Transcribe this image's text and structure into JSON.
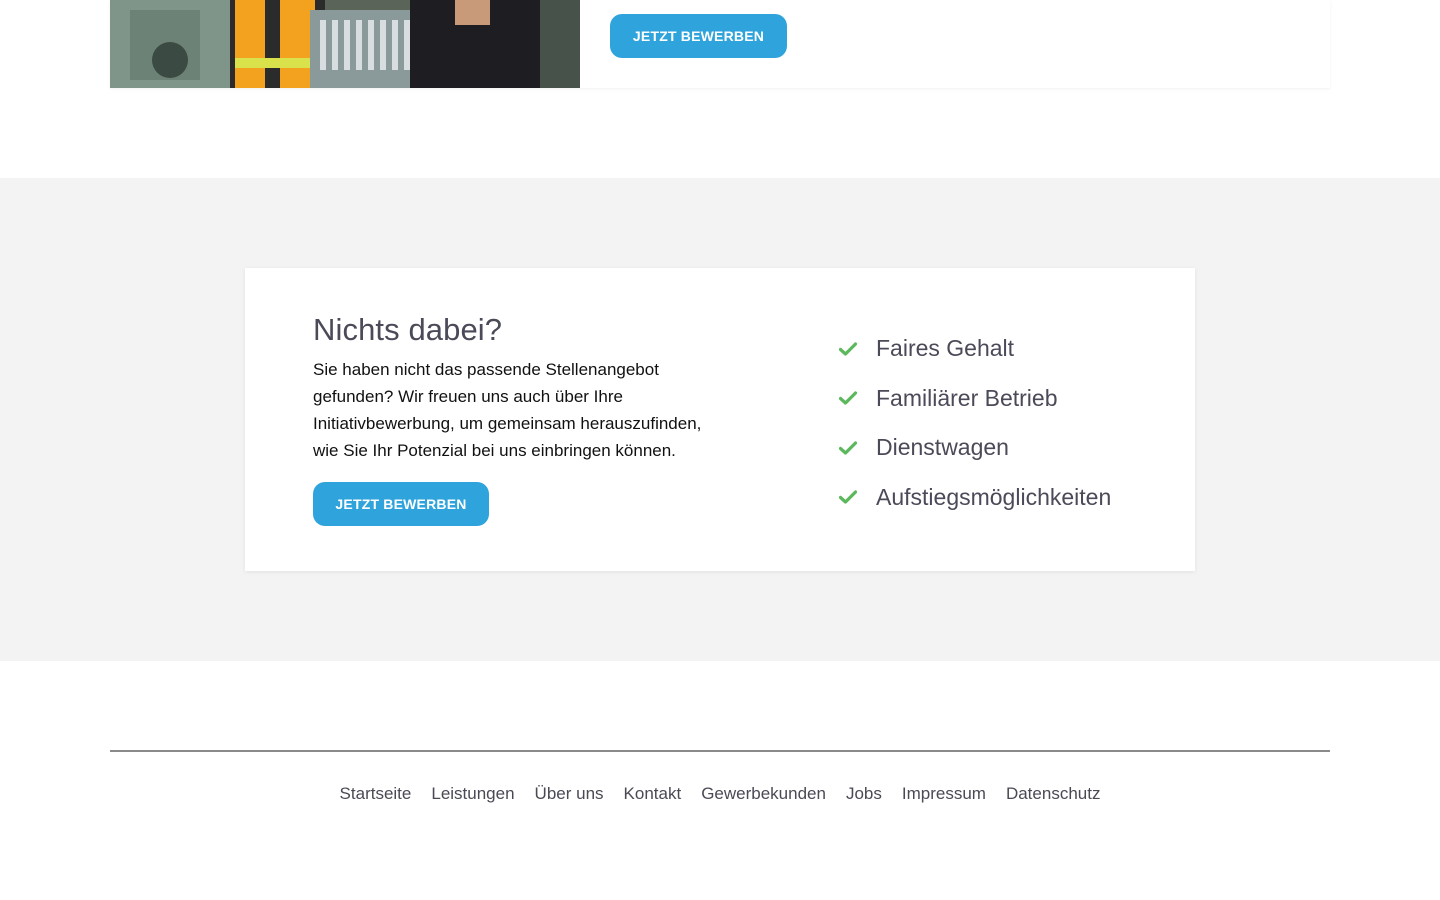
{
  "job_card": {
    "apply_label": "JETZT BEWERBEN",
    "image": "workers-at-machine-photo"
  },
  "cta": {
    "title": "Nichts dabei?",
    "text": "Sie haben nicht das passende Stellenangebot gefunden? Wir freuen uns auch über Ihre Initiativbewerbung, um gemeinsam herauszufinden, wie Sie Ihr Potenzial bei uns einbringen können.",
    "apply_label": "JETZT BEWERBEN",
    "benefits": [
      {
        "label": "Faires Gehalt",
        "icon": "check-icon"
      },
      {
        "label": "Familiärer Betrieb",
        "icon": "check-icon"
      },
      {
        "label": "Dienstwagen",
        "icon": "check-icon"
      },
      {
        "label": "Aufstiegsmöglichkeiten",
        "icon": "check-icon"
      }
    ]
  },
  "footer": {
    "links": [
      "Startseite",
      "Leistungen",
      "Über uns",
      "Kontakt",
      "Gewerbekunden",
      "Jobs",
      "Impressum",
      "Datenschutz"
    ]
  },
  "colors": {
    "accent": "#2fa3dc",
    "check": "#5cb85c",
    "band": "#f3f3f3"
  }
}
